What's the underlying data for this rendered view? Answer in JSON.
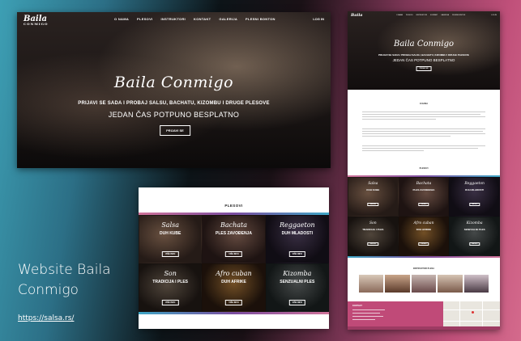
{
  "caption": {
    "title_line1": "Website Baila",
    "title_line2": "Conmigo",
    "link": "https://salsa.rs/"
  },
  "hero": {
    "logo": "Baila",
    "logo_sub": "CONMIGO",
    "nav": [
      "O NAMA",
      "PLESOVI",
      "INSTRUKTORI",
      "KONTAKT",
      "GALERIJA",
      "PLESNI BONTON"
    ],
    "login": "LOG IN",
    "script_title": "Baila Conmigo",
    "subtitle": "PRIJAVI SE SADA I PROBAJ SALSU, BACHATU, KIZOMBU I DRUGE PLESOVE",
    "tagline": "JEDAN ČAS POTPUNO BESPLATNO",
    "button": "PRIJAVI SE"
  },
  "plesovi": {
    "title": "PLESOVI",
    "tiles": [
      {
        "script": "Salsa",
        "name": "DUH KUBE",
        "button": "VIŠE INFO"
      },
      {
        "script": "Bachata",
        "name": "PLES ZAVOĐENJA",
        "button": "VIŠE INFO"
      },
      {
        "script": "Reggaeton",
        "name": "DUH MLADOSTI",
        "button": "VIŠE INFO"
      },
      {
        "script": "Son",
        "name": "TRADICIJA I PLES",
        "button": "VIŠE INFO"
      },
      {
        "script": "Afro cuban",
        "name": "DUH AFRIKE",
        "button": "VIŠE INFO"
      },
      {
        "script": "Kizomba",
        "name": "SENZUALNI PLES",
        "button": "VIŠE INFO"
      }
    ]
  },
  "full_page": {
    "about_title": "O NAMA",
    "ples_title": "PLESOVI",
    "instructors_title": "INSTRUKTORI PLESA",
    "footer_title": "KONTAKT"
  },
  "colors": {
    "accent_pink": "#c04a78",
    "accent_blue": "#3ea6c5",
    "accent_purple": "#7b4da0"
  }
}
